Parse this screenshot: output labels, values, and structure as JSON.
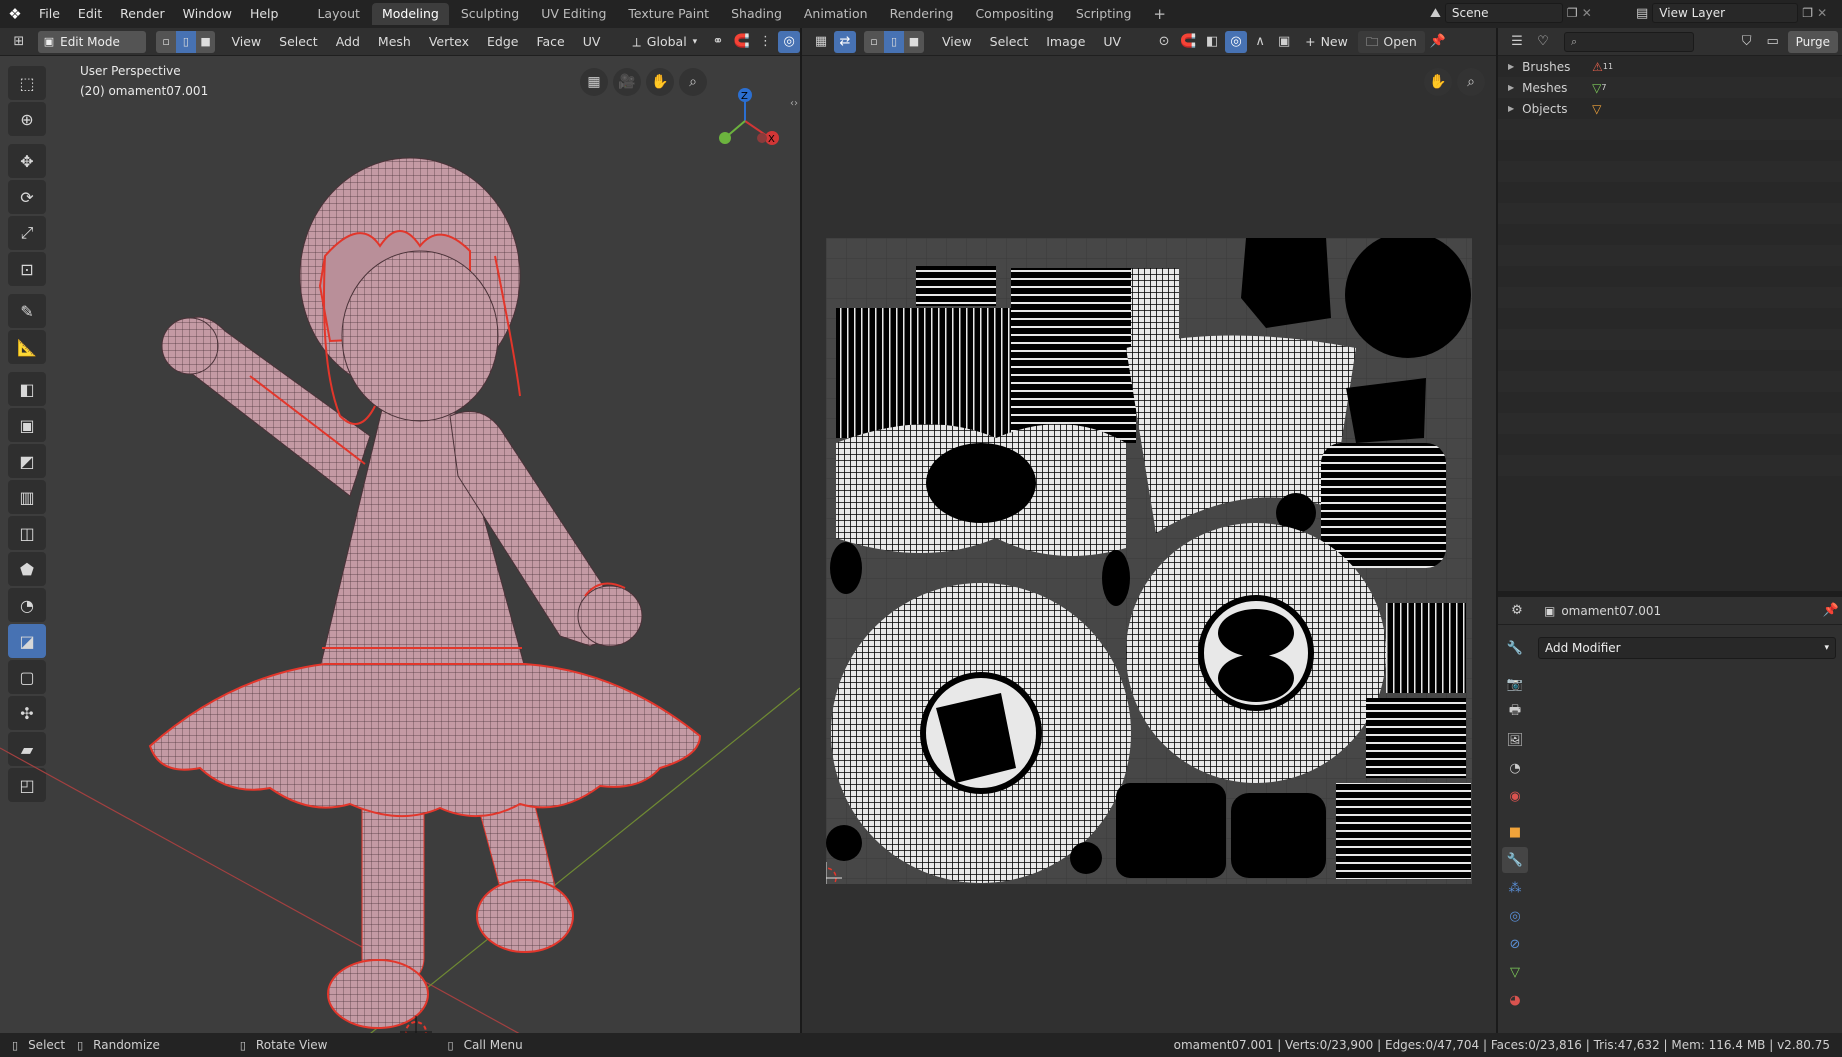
{
  "topbar": {
    "menu": [
      "File",
      "Edit",
      "Render",
      "Window",
      "Help"
    ],
    "workspaces": [
      "Layout",
      "Modeling",
      "Sculpting",
      "UV Editing",
      "Texture Paint",
      "Shading",
      "Animation",
      "Rendering",
      "Compositing",
      "Scripting"
    ],
    "active_workspace": "Modeling",
    "scene_name": "Scene",
    "view_layer_name": "View Layer"
  },
  "viewport_header": {
    "mode": "Edit Mode",
    "menus": [
      "View",
      "Select",
      "Add",
      "Mesh",
      "Vertex",
      "Edge",
      "Face",
      "UV"
    ],
    "transform_orientation": "Global"
  },
  "viewport": {
    "perspective_label": "User Perspective",
    "object_label": "(20) omament07.001",
    "gizmo_axes": [
      "Z",
      "X"
    ]
  },
  "uv_header": {
    "menus": [
      "View",
      "Select",
      "Image",
      "UV"
    ],
    "new_label": "New",
    "open_label": "Open"
  },
  "outliner": {
    "purge_label": "Purge",
    "items": [
      {
        "label": "Brushes",
        "badge": "11"
      },
      {
        "label": "Meshes",
        "badge": "7"
      },
      {
        "label": "Objects",
        "badge": ""
      }
    ]
  },
  "properties": {
    "object_name": "omament07.001",
    "add_modifier_label": "Add Modifier"
  },
  "statusbar": {
    "select_label": "Select",
    "randomize_label": "Randomize",
    "rotate_label": "Rotate View",
    "callmenu_label": "Call Menu",
    "stats": "omament07.001 | Verts:0/23,900 | Edges:0/47,704 | Faces:0/23,816 | Tris:47,632 | Mem: 116.4 MB | v2.80.75"
  },
  "colors": {
    "accent": "#4772b3",
    "mesh": "#c49aa4",
    "seam": "#e2362b"
  }
}
